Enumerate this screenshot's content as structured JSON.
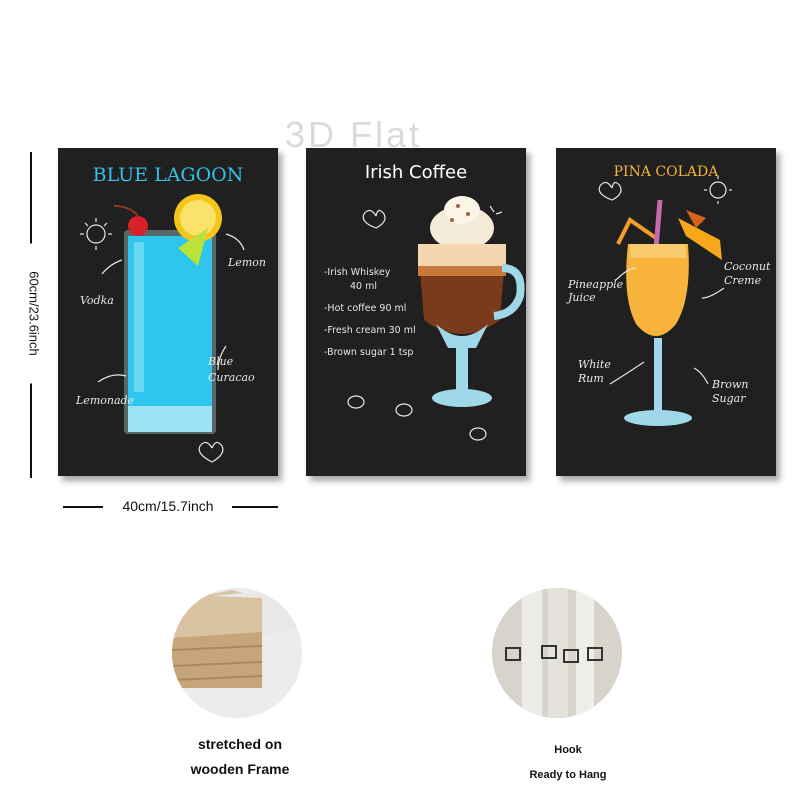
{
  "watermark": "3D Flat",
  "dimensions": {
    "height_label": "60cm/23.6inch",
    "width_label": "40cm/15.7inch"
  },
  "posters": [
    {
      "title": "BLUE LAGOON",
      "title_color": "#35c0e8",
      "labels": [
        "Lemon",
        "Vodka",
        "Blue Curacao",
        "Lemonade"
      ]
    },
    {
      "title": "Irish Coffee",
      "title_color": "#ffffff",
      "ingredients": [
        "-Irish Whiskey",
        "40 ml",
        "-Hot coffee 90 ml",
        "-Fresh cream 30 ml",
        "-Brown sugar 1 tsp"
      ]
    },
    {
      "title": "PINA COLADA",
      "title_color": "#f2b63a",
      "labels": [
        "Pineapple Juice",
        "Coconut Creme",
        "White Rum",
        "Brown Sugar"
      ]
    }
  ],
  "features": [
    {
      "caption_line1": "stretched on",
      "caption_line2": "wooden Frame",
      "icon": "wooden-frame-closeup"
    },
    {
      "caption_line1": "Hook",
      "caption_line2": "Ready to Hang",
      "icon": "hanging-hook-closeup"
    }
  ],
  "colors": {
    "panel_bg": "#202020",
    "blue_drink": "#2fc6ee",
    "coffee": "#7a3a1c",
    "pina": "#f7b33a",
    "glass_base": "#9fd8e8"
  }
}
